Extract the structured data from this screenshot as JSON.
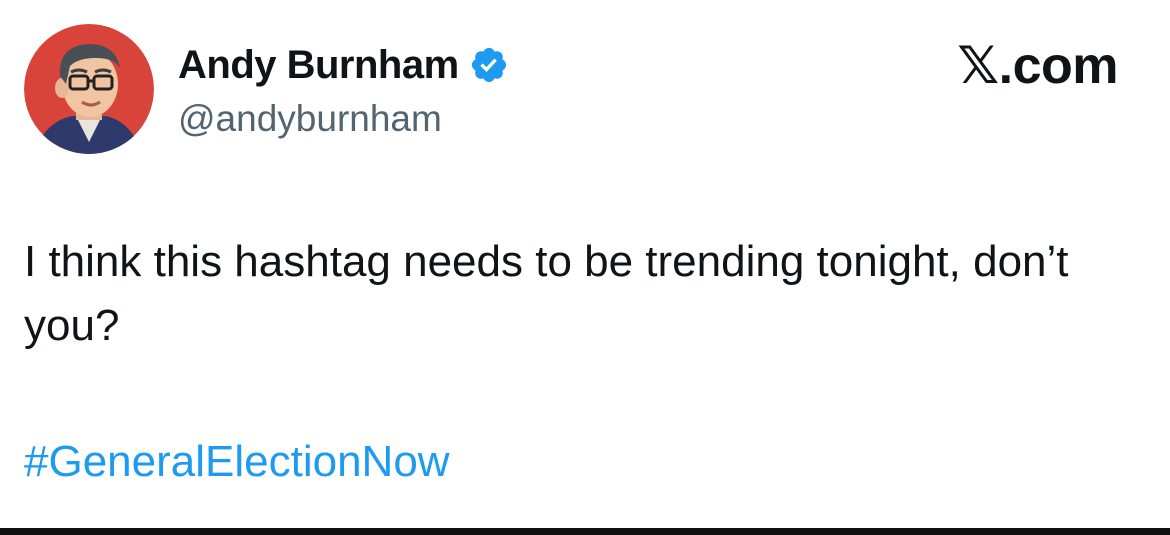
{
  "author": {
    "display_name": "Andy Burnham",
    "handle": "@andyburnham",
    "verified": true,
    "avatar_icon": "cartoon-portrait-avatar"
  },
  "platform": {
    "label": "𝕏.com"
  },
  "tweet": {
    "text": "I think this hashtag needs to be trending tonight, don’t you?",
    "hashtag": "#GeneralElectionNow"
  },
  "colors": {
    "avatar_background": "#d8443a",
    "verified_badge": "#1d9bf0",
    "hashtag": "#1d9bf0",
    "handle": "#536471",
    "text": "#0f1419"
  }
}
